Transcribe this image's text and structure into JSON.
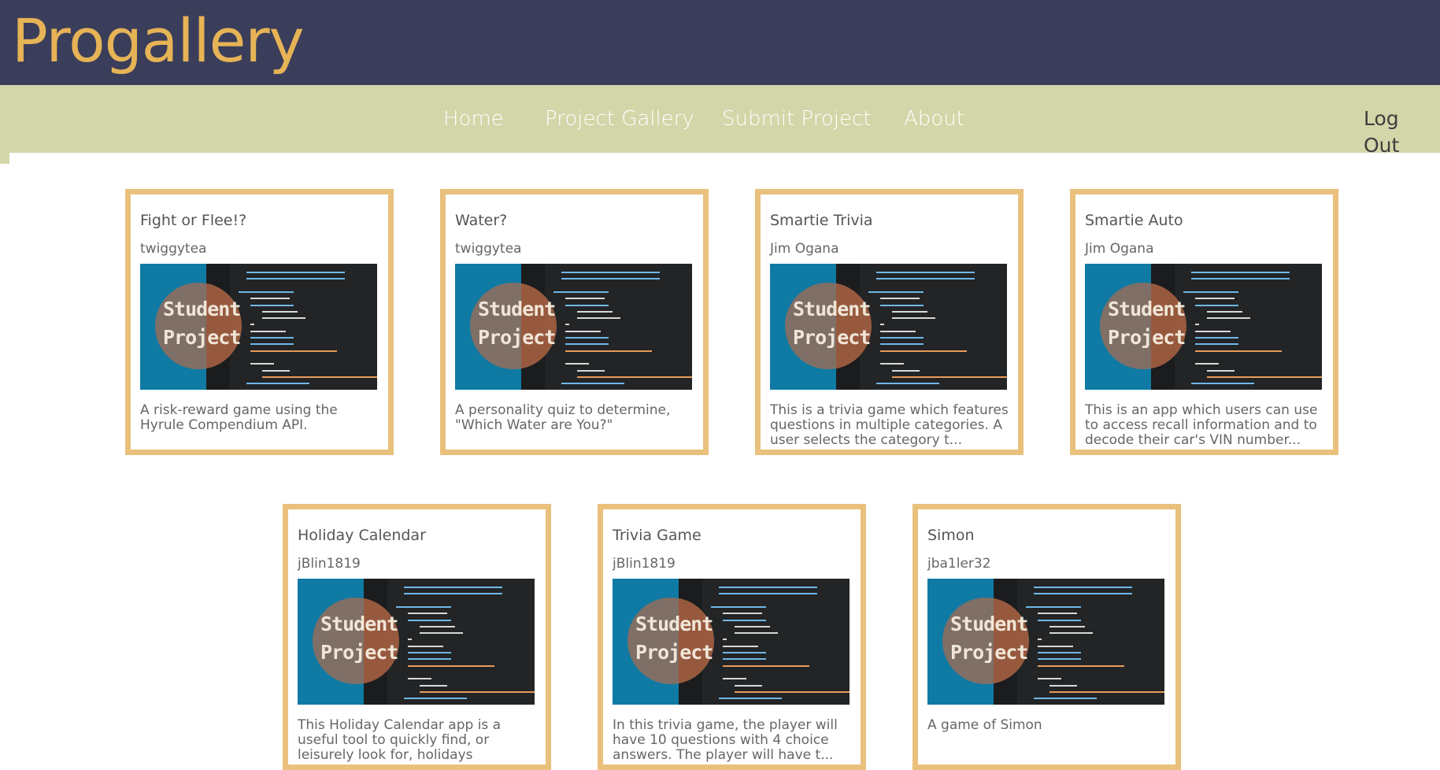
{
  "header": {
    "title": "Progallery"
  },
  "nav": {
    "links": [
      "Home",
      "Project Gallery",
      "Submit Project",
      "About"
    ],
    "logout": "Log Out"
  },
  "thumbnail": {
    "label_line1": "Student",
    "label_line2": "Project"
  },
  "projects": [
    {
      "title": "Fight or Flee!?",
      "author": "twiggytea",
      "description": "A risk-reward game using the Hyrule Compendium API."
    },
    {
      "title": "Water?",
      "author": "twiggytea",
      "description": "A personality quiz to determine, \"Which Water are You?\""
    },
    {
      "title": "Smartie Trivia",
      "author": "Jim Ogana",
      "description": "This is a trivia game which features questions in multiple categories. A user selects the category t..."
    },
    {
      "title": "Smartie Auto",
      "author": "Jim Ogana",
      "description": "This is an app which users can use to access recall information and to decode their car's VIN number..."
    },
    {
      "title": "Holiday Calendar",
      "author": "jBlin1819",
      "description": "This Holiday Calendar app is a useful tool to quickly find, or leisurely look for, holidays througho..."
    },
    {
      "title": "Trivia Game",
      "author": "jBlin1819",
      "description": "In this trivia game, the player will have 10 questions with 4 choice answers. The player will have t..."
    },
    {
      "title": "Simon",
      "author": "jba1ler32",
      "description": "A game of Simon"
    }
  ],
  "colors": {
    "header_bg": "#3b3e5a",
    "logo": "#e6b356",
    "nav_bg": "#d3d6a8",
    "card_border": "#e9c07c"
  }
}
